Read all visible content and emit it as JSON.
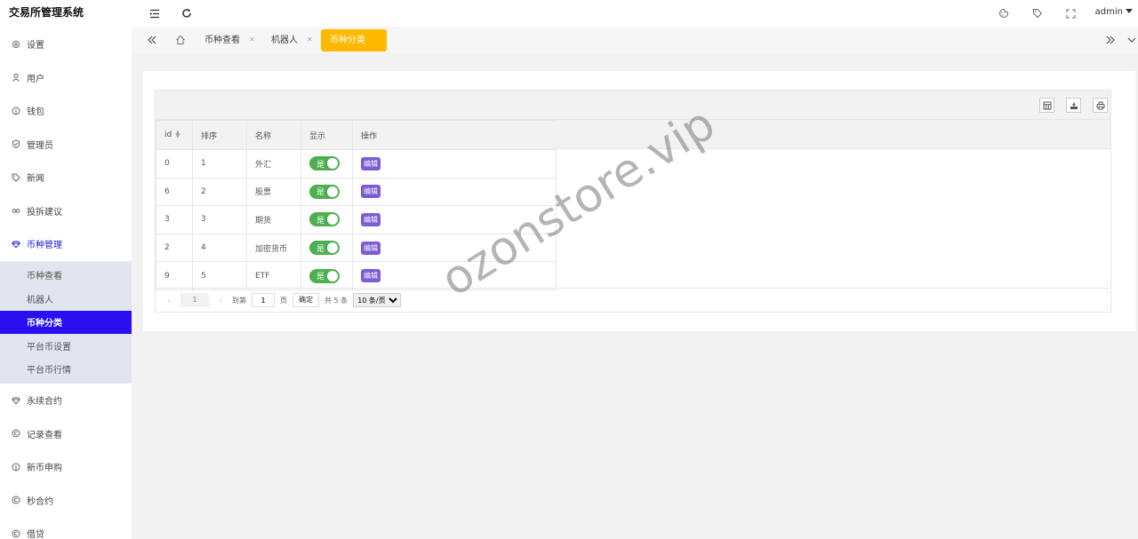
{
  "app": {
    "title": "交易所管理系统"
  },
  "sidebar": {
    "items_top": [
      {
        "label": "设置",
        "icon": "gear-icon"
      },
      {
        "label": "用户",
        "icon": "user-icon"
      },
      {
        "label": "钱包",
        "icon": "coin-icon"
      },
      {
        "label": "管理员",
        "icon": "shield-icon"
      },
      {
        "label": "新闻",
        "icon": "tag-icon"
      },
      {
        "label": "投拆建议",
        "icon": "link-icon"
      },
      {
        "label": "币种管理",
        "icon": "diamond-icon"
      }
    ],
    "submenu": [
      {
        "label": "币种查看"
      },
      {
        "label": "机器人"
      },
      {
        "label": "币种分类"
      },
      {
        "label": "平台币设置"
      },
      {
        "label": "平台币行情"
      }
    ],
    "items_bottom": [
      {
        "label": "永续合约",
        "icon": "diamond-icon"
      },
      {
        "label": "记录查看",
        "icon": "circle-c-icon"
      },
      {
        "label": "新币申购",
        "icon": "coin-icon"
      },
      {
        "label": "秒合约",
        "icon": "circle-c-icon"
      },
      {
        "label": "借贷",
        "icon": "circle-c-icon"
      }
    ]
  },
  "header": {
    "user": "admin"
  },
  "tabs": [
    {
      "label": "币种查看"
    },
    {
      "label": "机器人"
    },
    {
      "label": "币种分类"
    }
  ],
  "table": {
    "columns": [
      "id",
      "排序",
      "名称",
      "显示",
      "操作"
    ],
    "switch_label": "是",
    "edit_label": "编辑",
    "rows": [
      {
        "id": "0",
        "sort": "1",
        "name": "外汇"
      },
      {
        "id": "6",
        "sort": "2",
        "name": "股票"
      },
      {
        "id": "3",
        "sort": "3",
        "name": "期货"
      },
      {
        "id": "2",
        "sort": "4",
        "name": "加密货币"
      },
      {
        "id": "9",
        "sort": "5",
        "name": "ETF"
      }
    ]
  },
  "pager": {
    "current": "1",
    "goto_prefix": "到第",
    "page_value": "1",
    "page_suffix": "页",
    "confirm": "确定",
    "total": "共 5 条",
    "per_page": "10 条/页"
  },
  "watermark": "ozonstore.vip",
  "colors": {
    "accent": "#2a0ff0",
    "tab_active": "#ffb800",
    "switch_on": "#4caf50",
    "edit": "#7b5cd6"
  }
}
